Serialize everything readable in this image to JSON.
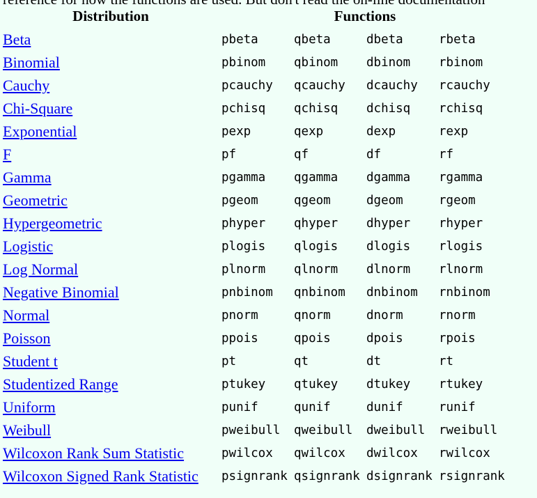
{
  "intro_text": "reference for how the functions are used. But don't read the on-line documentation",
  "table": {
    "headers": {
      "distribution": "Distribution",
      "functions": "Functions"
    },
    "rows": [
      {
        "name": "Beta",
        "fns": [
          "pbeta",
          "qbeta",
          "dbeta",
          "rbeta"
        ]
      },
      {
        "name": "Binomial",
        "fns": [
          "pbinom",
          "qbinom",
          "dbinom",
          "rbinom"
        ]
      },
      {
        "name": "Cauchy",
        "fns": [
          "pcauchy",
          "qcauchy",
          "dcauchy",
          "rcauchy"
        ]
      },
      {
        "name": "Chi-Square",
        "fns": [
          "pchisq",
          "qchisq",
          "dchisq",
          "rchisq"
        ]
      },
      {
        "name": "Exponential",
        "fns": [
          "pexp",
          "qexp",
          "dexp",
          "rexp"
        ]
      },
      {
        "name": "F",
        "fns": [
          "pf",
          "qf",
          "df",
          "rf"
        ]
      },
      {
        "name": "Gamma",
        "fns": [
          "pgamma",
          "qgamma",
          "dgamma",
          "rgamma"
        ]
      },
      {
        "name": "Geometric",
        "fns": [
          "pgeom",
          "qgeom",
          "dgeom",
          "rgeom"
        ]
      },
      {
        "name": "Hypergeometric",
        "fns": [
          "phyper",
          "qhyper",
          "dhyper",
          "rhyper"
        ]
      },
      {
        "name": "Logistic",
        "fns": [
          "plogis",
          "qlogis",
          "dlogis",
          "rlogis"
        ]
      },
      {
        "name": "Log Normal",
        "fns": [
          "plnorm",
          "qlnorm",
          "dlnorm",
          "rlnorm"
        ]
      },
      {
        "name": "Negative Binomial",
        "fns": [
          "pnbinom",
          "qnbinom",
          "dnbinom",
          "rnbinom"
        ]
      },
      {
        "name": "Normal",
        "fns": [
          "pnorm",
          "qnorm",
          "dnorm",
          "rnorm"
        ]
      },
      {
        "name": "Poisson",
        "fns": [
          "ppois",
          "qpois",
          "dpois",
          "rpois"
        ]
      },
      {
        "name": "Student t",
        "fns": [
          "pt",
          "qt",
          "dt",
          "rt"
        ]
      },
      {
        "name": "Studentized Range",
        "fns": [
          "ptukey",
          "qtukey",
          "dtukey",
          "rtukey"
        ]
      },
      {
        "name": "Uniform",
        "fns": [
          "punif",
          "qunif",
          "dunif",
          "runif"
        ]
      },
      {
        "name": "Weibull",
        "fns": [
          "pweibull",
          "qweibull",
          "dweibull",
          "rweibull"
        ]
      },
      {
        "name": "Wilcoxon Rank Sum Statistic",
        "fns": [
          "pwilcox",
          "qwilcox",
          "dwilcox",
          "rwilcox"
        ]
      },
      {
        "name": "Wilcoxon Signed Rank Statistic",
        "fns": [
          "psignrank",
          "qsignrank",
          "dsignrank",
          "rsignrank"
        ]
      }
    ]
  },
  "colors": {
    "background": "#f0fff8",
    "link": "#0000ee",
    "text": "#000000"
  }
}
